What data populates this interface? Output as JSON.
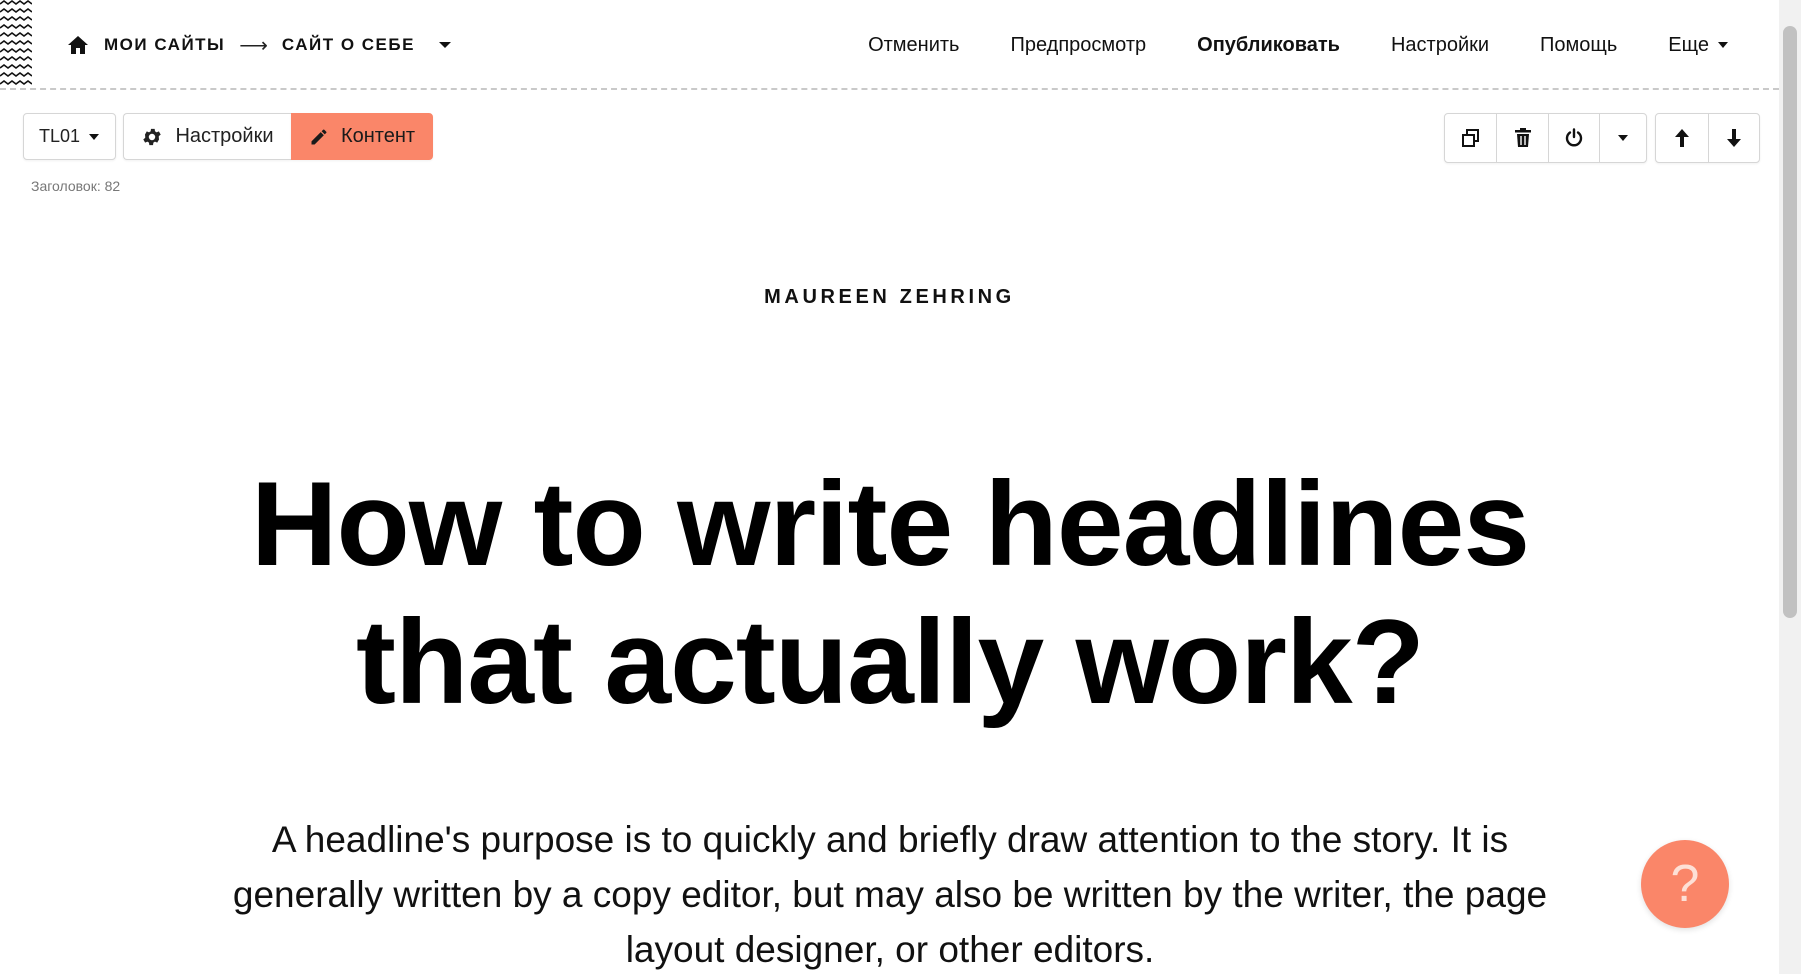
{
  "topbar": {
    "breadcrumb": {
      "home_icon": "home-icon",
      "my_sites": "МОИ САЙТЫ",
      "separator": "⟶",
      "current_site": "САЙТ О СЕБЕ"
    },
    "nav": {
      "undo": "Отменить",
      "preview": "Предпросмотр",
      "publish": "Опубликовать",
      "settings": "Настройки",
      "help": "Помощь",
      "more": "Еще"
    }
  },
  "block_toolbar": {
    "type_label": "TL01",
    "settings_label": "Настройки",
    "content_label": "Контент",
    "meta": "Заголовок: 82",
    "icons": {
      "duplicate": "duplicate-icon",
      "delete": "trash-icon",
      "toggle": "power-icon",
      "more": "caret-down-icon",
      "move_up": "arrow-up-icon",
      "move_down": "arrow-down-icon"
    }
  },
  "content": {
    "author": "MAUREEN ZEHRING",
    "headline_line1": "How to write headlines",
    "headline_line2": "that actually work?",
    "lead": "A headline's purpose is to quickly and briefly draw attention to the story. It is generally written by a copy editor, but may also be written by the writer, the page layout designer, or other editors."
  },
  "help_button": {
    "label": "?"
  },
  "colors": {
    "accent": "#fa8669",
    "border": "#d6d6d6",
    "text": "#111111"
  }
}
